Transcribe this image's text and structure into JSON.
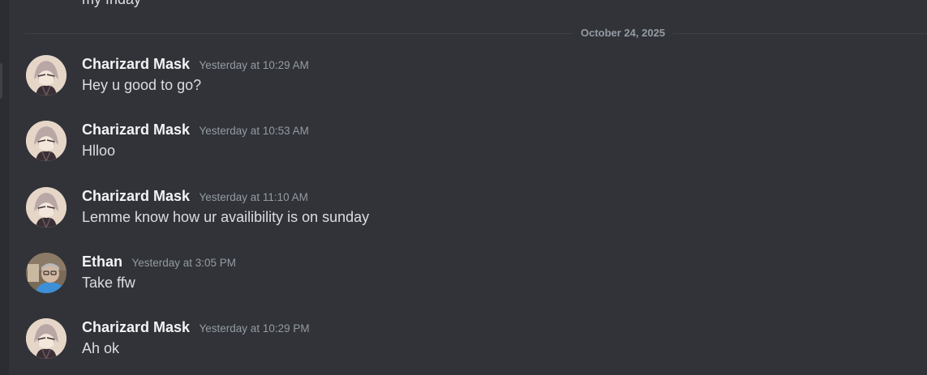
{
  "chat": {
    "previous_message_fragment": "my friday",
    "date_divider": "October 24, 2025",
    "messages": [
      {
        "author": "Charizard Mask",
        "timestamp": "Yesterday at 10:29 AM",
        "content": "Hey u good to go?"
      },
      {
        "author": "Charizard Mask",
        "timestamp": "Yesterday at 10:53 AM",
        "content": "Hlloo"
      },
      {
        "author": "Charizard Mask",
        "timestamp": "Yesterday at 11:10 AM",
        "content": "Lemme know how ur availibility is on sunday"
      },
      {
        "author": "Ethan",
        "timestamp": "Yesterday at 3:05 PM",
        "content": "Take ffw"
      },
      {
        "author": "Charizard Mask",
        "timestamp": "Yesterday at 10:29 PM",
        "content": "Ah ok"
      }
    ]
  },
  "colors": {
    "background": "#313338",
    "username": "#f2f3f5",
    "timestamp": "#949ba4",
    "message_text": "#dbdee1",
    "divider": "#3f4147"
  }
}
